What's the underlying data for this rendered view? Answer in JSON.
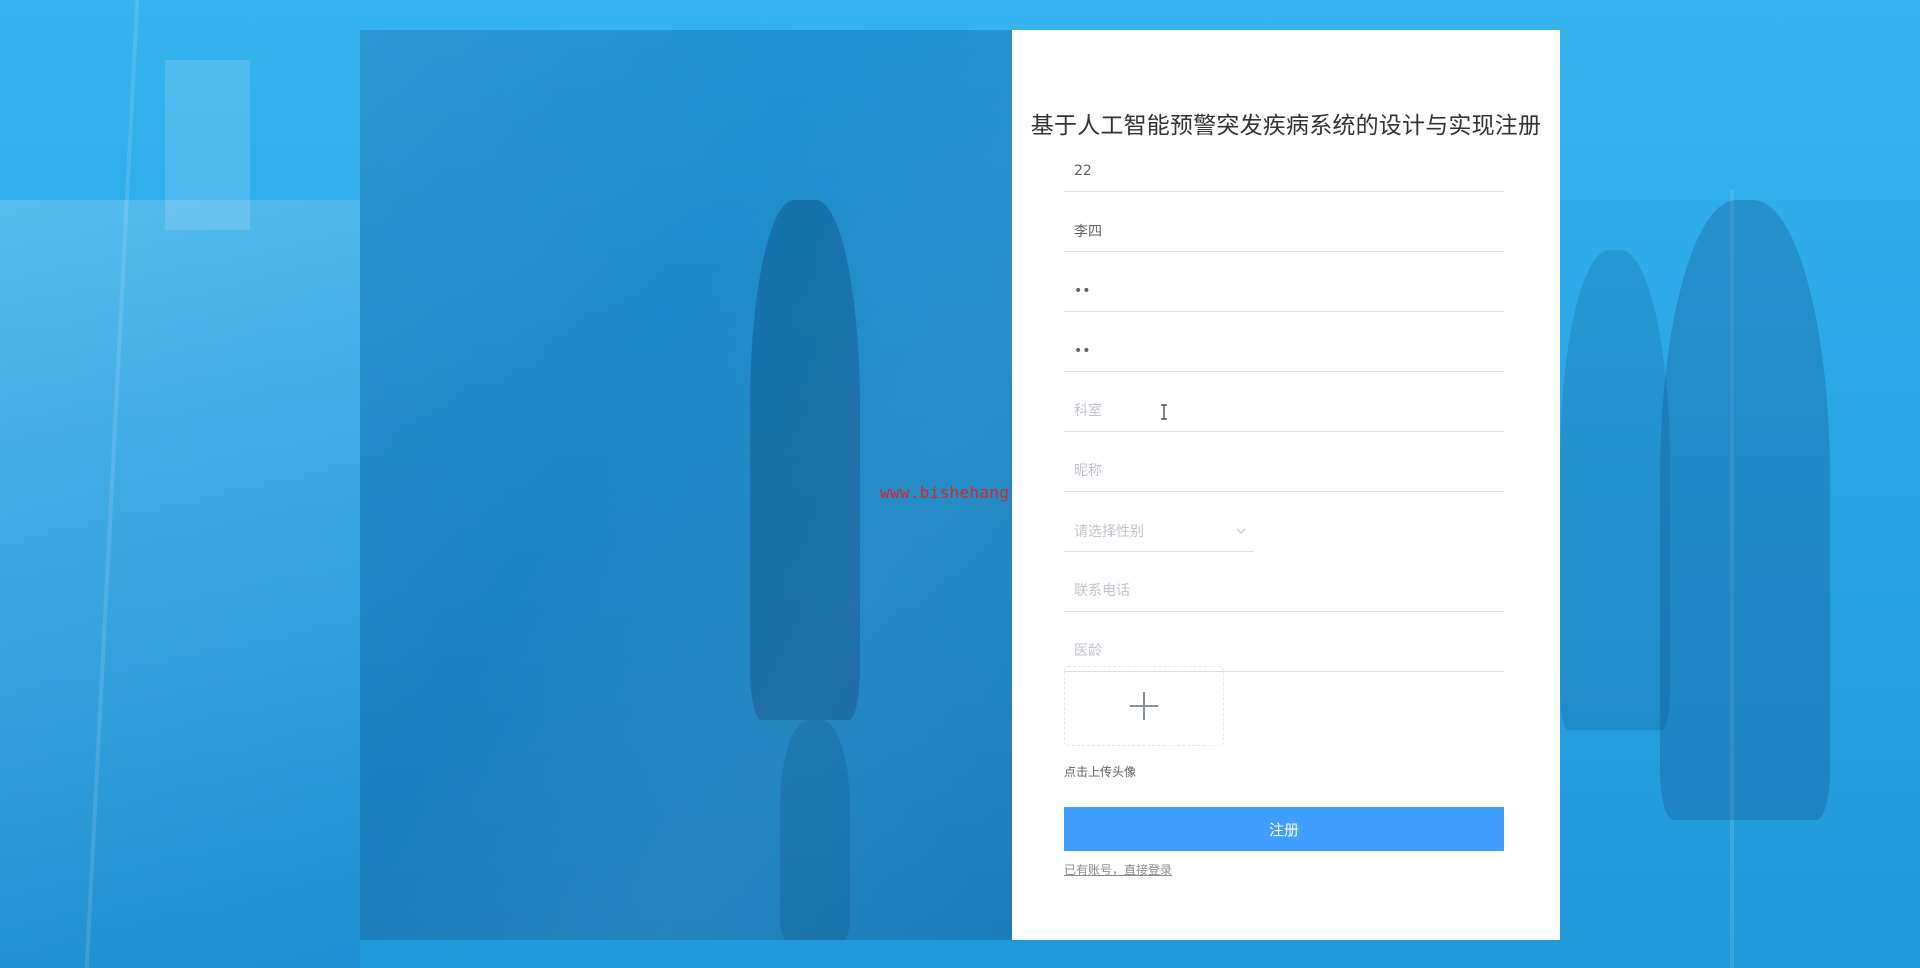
{
  "page": {
    "title": "基于人工智能预警突发疾病系统的设计与实现注册",
    "watermark": "www.bishehang.site"
  },
  "form": {
    "fields": [
      {
        "name": "account",
        "value": "22",
        "placeholder": ""
      },
      {
        "name": "name",
        "value": "李四",
        "placeholder": ""
      },
      {
        "name": "password",
        "value": "••",
        "placeholder": ""
      },
      {
        "name": "confirm_password",
        "value": "••",
        "placeholder": ""
      },
      {
        "name": "department",
        "value": "",
        "placeholder": "科室"
      },
      {
        "name": "nickname",
        "value": "",
        "placeholder": "昵称"
      },
      {
        "name": "phone",
        "value": "",
        "placeholder": "联系电话"
      },
      {
        "name": "years",
        "value": "",
        "placeholder": "医龄"
      }
    ],
    "gender_select": {
      "placeholder": "请选择性别"
    },
    "upload_hint": "点击上传头像",
    "register_label": "注册",
    "login_link": "已有账号，直接登录"
  },
  "colors": {
    "primary": "#409eff",
    "background": "#2aa6e4",
    "watermark": "#d9252a"
  },
  "icons": {
    "upload": "plus-icon",
    "select": "chevron-down-icon",
    "cursor": "text-cursor-icon"
  }
}
